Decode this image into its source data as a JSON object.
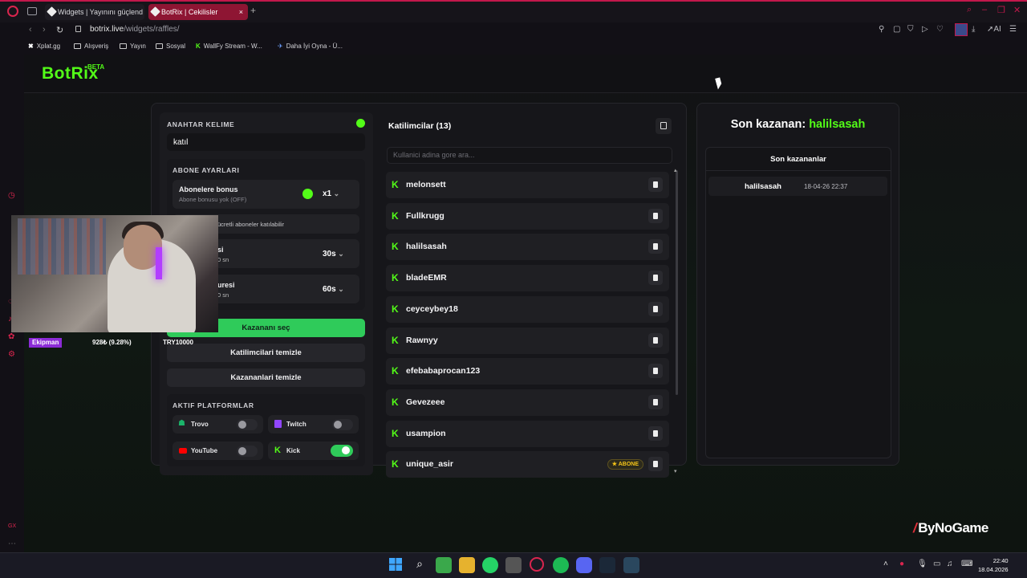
{
  "browser": {
    "tabs": [
      {
        "title": "Widgets | Yayınını güçlend",
        "active": false
      },
      {
        "title": "BotRix | Cekilisler",
        "active": true
      }
    ],
    "url_host": "botrix.live",
    "url_path": "/widgets/raffles/",
    "bookmarks": [
      "Xplat.gg",
      "Alışveriş",
      "Yayın",
      "Sosyal",
      "WallFy Stream - W...",
      "Daha İyi Oyna - Ü..."
    ],
    "ai_label": "AI"
  },
  "brand": {
    "logo": "BotRix",
    "beta": "BETA",
    "accent": "#53fc18"
  },
  "settings": {
    "keyword_label": "ANAHTAR KELIME",
    "keyword_value": "katıl",
    "sub_settings_label": "ABONE AYARLARI",
    "sub_bonus_title": "Abonelere bonus",
    "sub_bonus_desc": "Abone bonusu yok (OFF)",
    "sub_bonus_multiplier": "x1",
    "free_subs_text": "ücretli aboneler katılabilir",
    "timer1_title": "si",
    "timer1_desc": "0 sn",
    "timer1_value": "30s",
    "timer2_title": "uresi",
    "timer2_desc": "0 sn",
    "timer2_value": "60s",
    "pick_winner_button": "Kazananı seç",
    "clear_participants_button": "Katilimcilari temizle",
    "clear_winners_button": "Kazananlari temizle",
    "platforms_label": "AKTIF PLATFORMLAR",
    "platforms": [
      {
        "name": "Trovo",
        "enabled": false,
        "color": "#1bb46a"
      },
      {
        "name": "Twitch",
        "enabled": false,
        "color": "#9146ff"
      },
      {
        "name": "YouTube",
        "enabled": false,
        "color": "#ff0000"
      },
      {
        "name": "Kick",
        "enabled": true,
        "color": "#53fc18"
      }
    ]
  },
  "participants": {
    "title": "Katilimcilar (13)",
    "search_placeholder": "Kullanici adina gore ara...",
    "list": [
      {
        "name": "melonsett",
        "badge": ""
      },
      {
        "name": "Fullkrugg",
        "badge": ""
      },
      {
        "name": "halilsasah",
        "badge": ""
      },
      {
        "name": "bladeEMR",
        "badge": ""
      },
      {
        "name": "ceyceybey18",
        "badge": ""
      },
      {
        "name": "Rawnyy",
        "badge": ""
      },
      {
        "name": "efebabaprocan123",
        "badge": ""
      },
      {
        "name": "Gevezeee",
        "badge": ""
      },
      {
        "name": "usampion",
        "badge": ""
      },
      {
        "name": "unique_asir",
        "badge": "★ ABONE"
      }
    ]
  },
  "winners": {
    "last_winner_label": "Son kazanan:",
    "last_winner_name": "halilsasah",
    "recent_title": "Son kazananlar",
    "recent": [
      {
        "name": "halilsasah",
        "time": "18-04-26 22:37"
      }
    ]
  },
  "stream_overlay": {
    "label": "Ekipman",
    "progress_text": "928₺ (9.28%)",
    "goal_text": "TRY10000"
  },
  "watermark": "ByNoGame",
  "taskbar": {
    "time": "22:40",
    "date": "18.04.2026"
  }
}
